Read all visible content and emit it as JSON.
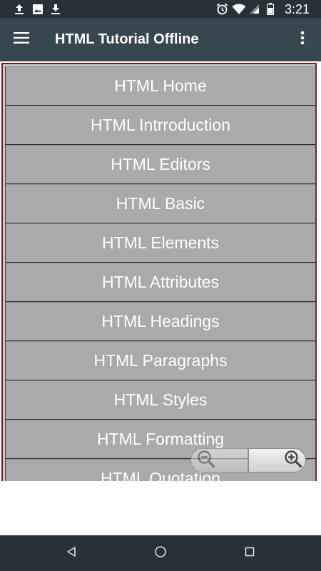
{
  "status_bar": {
    "time": "3:21",
    "left_icons": [
      "upload-icon",
      "image-icon",
      "download-icon"
    ],
    "right_icons": [
      "alarm-icon",
      "wifi-icon",
      "signal-icon",
      "battery-icon"
    ]
  },
  "app_bar": {
    "title": "HTML Tutorial Offline",
    "menu_icon": "hamburger-menu-icon",
    "overflow_icon": "more-vert-icon",
    "background": "#37474f"
  },
  "menu": {
    "items": [
      {
        "label": "HTML Home"
      },
      {
        "label": "HTML Intrroduction"
      },
      {
        "label": "HTML Editors"
      },
      {
        "label": "HTML Basic"
      },
      {
        "label": "HTML Elements"
      },
      {
        "label": "HTML Attributes"
      },
      {
        "label": "HTML Headings"
      },
      {
        "label": "HTML Paragraphs"
      },
      {
        "label": "HTML Styles"
      },
      {
        "label": "HTML Formatting"
      },
      {
        "label": "HTML Quotation"
      }
    ],
    "item_background": "#aaaaaa",
    "frame_border": "#6b1f1f"
  },
  "zoom": {
    "zoom_out_icon": "zoom-out-icon",
    "zoom_in_icon": "zoom-in-icon"
  },
  "nav_bar": {
    "back_icon": "back-triangle-icon",
    "home_icon": "home-circle-icon",
    "recents_icon": "recents-square-icon"
  }
}
